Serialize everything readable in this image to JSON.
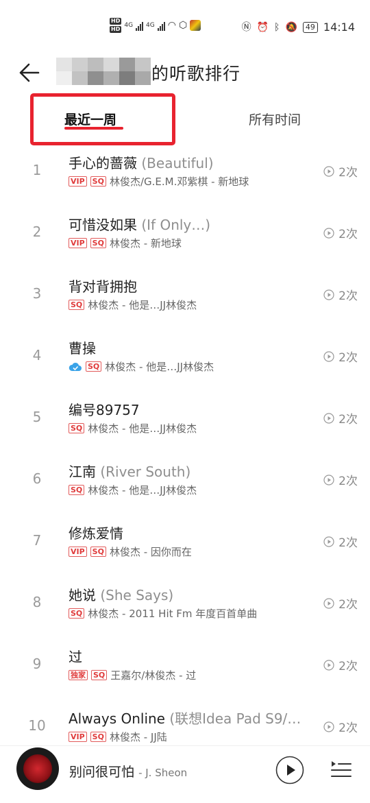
{
  "status": {
    "time": "14:14",
    "battery": "49",
    "network_left": "4G",
    "network_right": "4G",
    "hd": [
      "HD",
      "HD"
    ]
  },
  "header": {
    "title": "的听歌排行"
  },
  "tabs": [
    {
      "label": "最近一周",
      "active": true
    },
    {
      "label": "所有时间",
      "active": false
    }
  ],
  "songs": [
    {
      "rank": "1",
      "title": "手心的蔷薇",
      "subtitle": "(Beautiful)",
      "tags": [
        "VIP",
        "SQ"
      ],
      "artist_album": "林俊杰/G.E.M.邓紫棋 - 新地球",
      "plays": "2次"
    },
    {
      "rank": "2",
      "title": "可惜没如果",
      "subtitle": "(If Only…)",
      "tags": [
        "VIP",
        "SQ"
      ],
      "artist_album": "林俊杰 - 新地球",
      "plays": "2次"
    },
    {
      "rank": "3",
      "title": "背对背拥抱",
      "subtitle": "",
      "tags": [
        "SQ"
      ],
      "artist_album": "林俊杰 - 他是…JJ林俊杰",
      "plays": "2次"
    },
    {
      "rank": "4",
      "title": "曹操",
      "subtitle": "",
      "tags": [
        "cloud",
        "SQ"
      ],
      "artist_album": "林俊杰 - 他是…JJ林俊杰",
      "plays": "2次"
    },
    {
      "rank": "5",
      "title": "编号89757",
      "subtitle": "",
      "tags": [
        "SQ"
      ],
      "artist_album": "林俊杰 - 他是…JJ林俊杰",
      "plays": "2次"
    },
    {
      "rank": "6",
      "title": "江南",
      "subtitle": "(River South)",
      "tags": [
        "SQ"
      ],
      "artist_album": "林俊杰 - 他是…JJ林俊杰",
      "plays": "2次"
    },
    {
      "rank": "7",
      "title": "修炼爱情",
      "subtitle": "",
      "tags": [
        "VIP",
        "SQ"
      ],
      "artist_album": "林俊杰 - 因你而在",
      "plays": "2次"
    },
    {
      "rank": "8",
      "title": "她说",
      "subtitle": "(She Says)",
      "tags": [
        "SQ"
      ],
      "artist_album": "林俊杰 - 2011 Hit Fm 年度百首单曲",
      "plays": "2次"
    },
    {
      "rank": "9",
      "title": "过",
      "subtitle": "",
      "tags": [
        "独家",
        "SQ"
      ],
      "artist_album": "王嘉尔/林俊杰 - 过",
      "plays": "2次"
    },
    {
      "rank": "10",
      "title": "Always Online",
      "subtitle": "(联想Idea Pad S9/…",
      "tags": [
        "VIP",
        "SQ"
      ],
      "artist_album": "林俊杰 - JJ陆",
      "plays": "2次"
    }
  ],
  "now_playing": {
    "title": "别问很可怕",
    "artist": "- J. Sheon"
  },
  "colors": {
    "accent_red": "#e8232f",
    "tag_red": "#e03c3c",
    "cloud_blue": "#3aa3e8"
  }
}
